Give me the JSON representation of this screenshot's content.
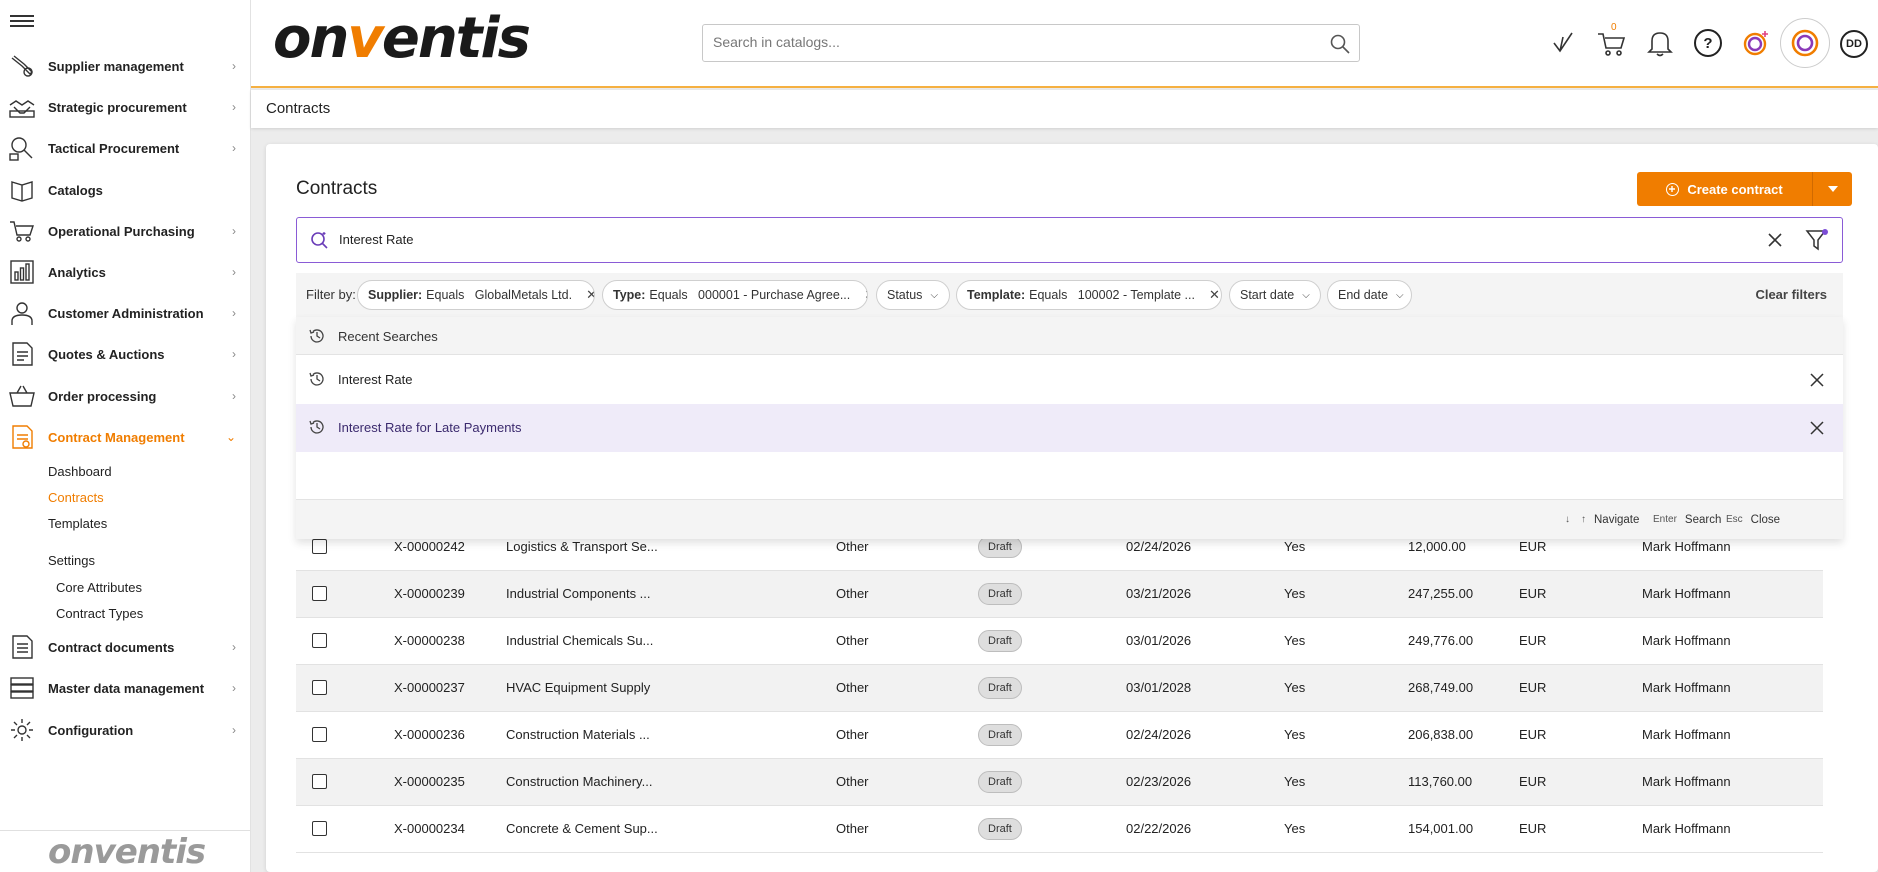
{
  "sidebar": {
    "items": [
      {
        "label": "Supplier management",
        "icon": "supplier-icon"
      },
      {
        "label": "Strategic procurement",
        "icon": "handshake-icon"
      },
      {
        "label": "Tactical Procurement",
        "icon": "magnifier-icon"
      },
      {
        "label": "Catalogs",
        "icon": "book-icon"
      },
      {
        "label": "Operational Purchasing",
        "icon": "cart-icon"
      },
      {
        "label": "Analytics",
        "icon": "bar-chart-icon"
      },
      {
        "label": "Customer Administration",
        "icon": "person-icon"
      },
      {
        "label": "Quotes & Auctions",
        "icon": "document-icon"
      },
      {
        "label": "Order processing",
        "icon": "basket-icon"
      },
      {
        "label": "Contract Management",
        "icon": "contract-icon"
      },
      {
        "label": "Contract documents",
        "icon": "document-list-icon"
      },
      {
        "label": "Master data management",
        "icon": "database-icon"
      },
      {
        "label": "Configuration",
        "icon": "gear-icon"
      }
    ],
    "contract_sub": {
      "dashboard": "Dashboard",
      "contracts": "Contracts",
      "templates": "Templates",
      "settings": "Settings",
      "core_attributes": "Core Attributes",
      "contract_types": "Contract Types"
    },
    "footer_logo": "onventis"
  },
  "header": {
    "logo_pre": "on",
    "logo_v": "v",
    "logo_post": "entis",
    "search_placeholder": "Search in catalogs...",
    "cart_count": "0",
    "avatar_initials": "DD",
    "help": "?"
  },
  "breadcrumb": "Contracts",
  "main": {
    "title": "Contracts",
    "create_label": "Create contract",
    "search_value": "Interest Rate",
    "filter_by": "Filter by:",
    "filters": [
      {
        "key": "Supplier:",
        "value": "Equals   GlobalMetals Ltd.",
        "clearable": true
      },
      {
        "key": "Type:",
        "value": "Equals   000001 - Purchase Agree...",
        "clearable": true
      },
      {
        "key": "",
        "value": "Status",
        "clearable": false
      },
      {
        "key": "Template:",
        "value": "Equals   100002 - Template ...",
        "clearable": true
      },
      {
        "key": "",
        "value": "Start date",
        "clearable": false
      },
      {
        "key": "",
        "value": "End date",
        "clearable": false
      }
    ],
    "clear_filters": "Clear filters",
    "dropdown": {
      "recent_label": "Recent Searches",
      "items": [
        "Interest Rate",
        "Interest Rate for Late Payments"
      ],
      "footer": {
        "navigate": "Navigate",
        "enter_key": "Enter",
        "search": "Search",
        "esc_key": "Esc",
        "close": "Close"
      }
    },
    "rows": [
      {
        "id": "X-00000242",
        "name": "Logistics & Transport Se...",
        "type": "Other",
        "status": "Draft",
        "date": "02/24/2026",
        "flag": "Yes",
        "amount": "12,000.00",
        "currency": "EUR",
        "owner": "Mark Hoffmann"
      },
      {
        "id": "X-00000239",
        "name": "Industrial Components ...",
        "type": "Other",
        "status": "Draft",
        "date": "03/21/2026",
        "flag": "Yes",
        "amount": "247,255.00",
        "currency": "EUR",
        "owner": "Mark Hoffmann"
      },
      {
        "id": "X-00000238",
        "name": "Industrial Chemicals Su...",
        "type": "Other",
        "status": "Draft",
        "date": "03/01/2026",
        "flag": "Yes",
        "amount": "249,776.00",
        "currency": "EUR",
        "owner": "Mark Hoffmann"
      },
      {
        "id": "X-00000237",
        "name": "HVAC Equipment Supply",
        "type": "Other",
        "status": "Draft",
        "date": "03/01/2028",
        "flag": "Yes",
        "amount": "268,749.00",
        "currency": "EUR",
        "owner": "Mark Hoffmann"
      },
      {
        "id": "X-00000236",
        "name": "Construction Materials ...",
        "type": "Other",
        "status": "Draft",
        "date": "02/24/2026",
        "flag": "Yes",
        "amount": "206,838.00",
        "currency": "EUR",
        "owner": "Mark Hoffmann"
      },
      {
        "id": "X-00000235",
        "name": "Construction Machinery...",
        "type": "Other",
        "status": "Draft",
        "date": "02/23/2026",
        "flag": "Yes",
        "amount": "113,760.00",
        "currency": "EUR",
        "owner": "Mark Hoffmann"
      },
      {
        "id": "X-00000234",
        "name": "Concrete & Cement Sup...",
        "type": "Other",
        "status": "Draft",
        "date": "02/22/2026",
        "flag": "Yes",
        "amount": "154,001.00",
        "currency": "EUR",
        "owner": "Mark Hoffmann"
      }
    ]
  },
  "colors": {
    "accent": "#f07d00",
    "purple_focus": "#8a5bd6",
    "highlight_row": "#efebf9"
  }
}
